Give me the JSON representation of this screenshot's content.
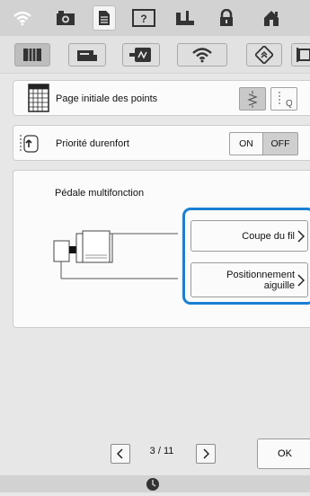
{
  "top_tabs": [
    "wifi-icon",
    "camera-icon",
    "settings-page-icon",
    "help-icon",
    "sewing-icon",
    "lock-icon",
    "home-icon"
  ],
  "sub_tabs": [
    "sewing-settings-icon",
    "machine-settings-icon",
    "embroidery-icon",
    "wireless-icon",
    "ordering-icon",
    "frame-icon"
  ],
  "settings": {
    "start_point": {
      "label": "Page initiale des points"
    },
    "durenfort": {
      "label": "Priorité durenfort",
      "on": "ON",
      "off": "OFF",
      "selected": "OFF"
    },
    "pedal": {
      "label": "Pédale multifonction"
    }
  },
  "pedal_actions": [
    {
      "label": "Coupe du fil"
    },
    {
      "label": "Positionnement",
      "label2": "aiguille"
    }
  ],
  "pager": {
    "current": "3",
    "separator": "/",
    "total": "11"
  },
  "ok_label": "OK",
  "colors": {
    "highlight": "#1a7fd4",
    "background": "#e7e7e7"
  }
}
